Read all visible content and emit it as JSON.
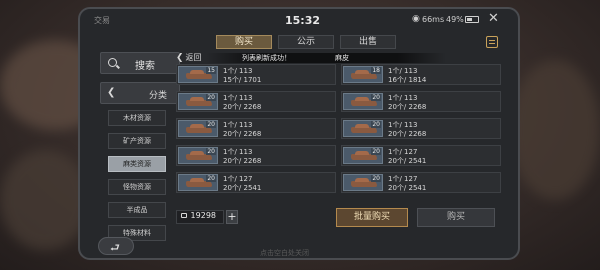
{
  "status_bar": {
    "title": "交易",
    "time": "15:32",
    "network": "66ms",
    "battery": "49%",
    "battery_level": 0.49
  },
  "tabs": [
    {
      "label": "购买",
      "active": true
    },
    {
      "label": "公示",
      "active": false
    },
    {
      "label": "出售",
      "active": false
    }
  ],
  "sidebar": {
    "search_label": "搜索",
    "category_label": "分类",
    "items": [
      {
        "label": "木材资源",
        "active": false
      },
      {
        "label": "矿产资源",
        "active": false
      },
      {
        "label": "麻类资源",
        "active": true
      },
      {
        "label": "怪物资源",
        "active": false
      },
      {
        "label": "半成品",
        "active": false
      },
      {
        "label": "特殊材料",
        "active": false
      }
    ]
  },
  "list": {
    "back_label": "返回",
    "toast": "列表刷新成功！",
    "item_name": "麻皮",
    "items": [
      {
        "level": "15",
        "line1": "1个/  113",
        "line2": "15个/  1701"
      },
      {
        "level": "18",
        "line1": "1个/  113",
        "line2": "16个/  1814"
      },
      {
        "level": "20",
        "line1": "1个/  113",
        "line2": "20个/  2268"
      },
      {
        "level": "20",
        "line1": "1个/  113",
        "line2": "20个/  2268"
      },
      {
        "level": "20",
        "line1": "1个/  113",
        "line2": "20个/  2268"
      },
      {
        "level": "20",
        "line1": "1个/  113",
        "line2": "20个/  2268"
      },
      {
        "level": "20",
        "line1": "1个/  113",
        "line2": "20个/  2268"
      },
      {
        "level": "20",
        "line1": "1个/  127",
        "line2": "20个/  2541"
      },
      {
        "level": "20",
        "line1": "1个/  127",
        "line2": "20个/  2541"
      },
      {
        "level": "20",
        "line1": "1个/  127",
        "line2": "20个/  2541"
      }
    ]
  },
  "footer": {
    "balance": "19298",
    "add_label": "+",
    "bulk_buy_label": "批量购买",
    "buy_label": "购买"
  },
  "bottom_hint": "点击空白处关闭",
  "icons": {
    "search": "search-icon",
    "back": "chevron-left-icon",
    "coin": "coin-icon",
    "return": "return-arrow-icon",
    "close": "close-icon",
    "notebook": "notebook-icon"
  },
  "colors": {
    "accent": "#b48a4e",
    "active_tab": "#6b5a3e"
  }
}
